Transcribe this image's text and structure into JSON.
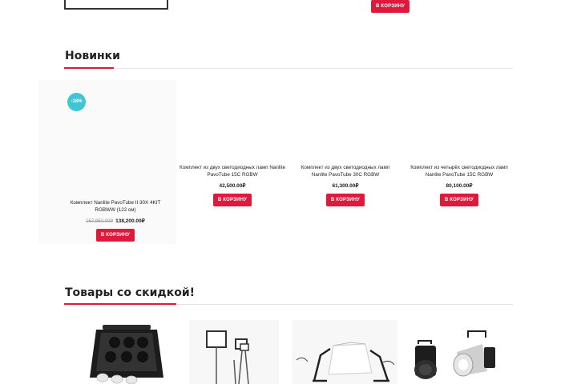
{
  "top": {
    "cart_label": "В КОРЗИНУ"
  },
  "new_section": {
    "title": "Новинки",
    "products": [
      {
        "name": "Комплект Nanlite PavoTube II 30X 4KIT RGBWW (122 см)",
        "old_price": "167,950.00₽",
        "price": "138,200.00₽",
        "badge": "-18%",
        "cart_label": "В КОРЗИНУ"
      },
      {
        "name": "Комплект из двух светодиодных ламп Nanlite PavoTube 15C RGBW",
        "price": "42,500.00₽",
        "cart_label": "В КОРЗИНУ"
      },
      {
        "name": "Комплект из двух светодиодных ламп Nanlite PavoTube 30C RGBW",
        "price": "61,300.00₽",
        "cart_label": "В КОРЗИНУ"
      },
      {
        "name": "Комплект из четырёх светодиодных ламп Nanlite PavoTube 15C RGBW",
        "price": "80,100.00₽",
        "cart_label": "В КОРЗИНУ"
      }
    ]
  },
  "discount_section": {
    "title": "Товары со скидкой!",
    "images": [
      "equipment-case-image",
      "led-panel-stands-image",
      "photo-tent-image",
      "spotlights-image"
    ]
  },
  "colors": {
    "accent": "#e0183c",
    "badge": "#3fc6d6"
  }
}
